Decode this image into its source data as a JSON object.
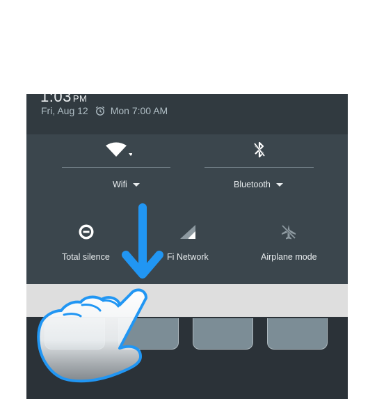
{
  "status": {
    "time": "1:03",
    "ampm": "PM",
    "date": "Fri, Aug 12",
    "alarm": "Mon 7:00 AM"
  },
  "quick_settings": {
    "wifi_label": "Wifi",
    "bluetooth_label": "Bluetooth",
    "total_silence_label": "Total silence",
    "network_label": "Fi Network",
    "airplane_label": "Airplane mode"
  },
  "gesture": {
    "direction": "swipe-down",
    "arrow_color": "#2196f3"
  },
  "icons": [
    "wifi-icon",
    "bluetooth-icon",
    "alarm-icon",
    "total-silence-icon",
    "signal-icon",
    "airplane-icon",
    "hand-pointer-icon",
    "arrow-down-icon"
  ]
}
